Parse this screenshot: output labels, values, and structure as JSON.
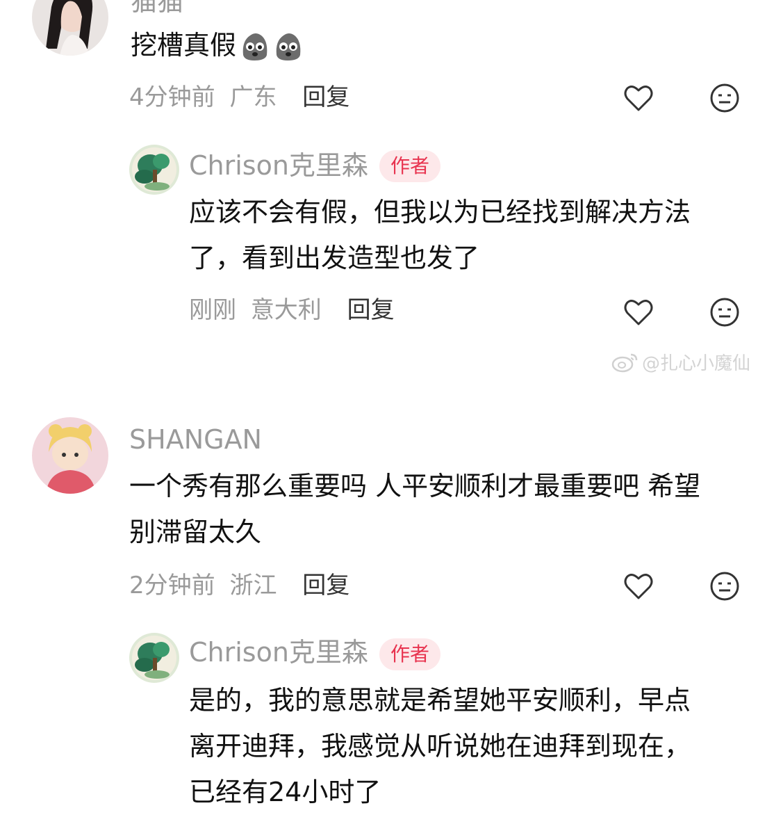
{
  "comments": [
    {
      "user": "猫猫",
      "text": "挖槽真假",
      "emoji_count": 2,
      "time": "4分钟前",
      "location": "广东",
      "reply_label": "回复",
      "replies": [
        {
          "user": "Chrison克里森",
          "badge": "作者",
          "text_line1": "应该不会有假，但我以为已经找到解决方法",
          "text_line2": "了，看到出发造型也发了",
          "time": "刚刚",
          "location": "意大利",
          "reply_label": "回复"
        }
      ]
    },
    {
      "user": "SHANGAN",
      "text_line1": "一个秀有那么重要吗 人平安顺利才最重要吧 希望",
      "text_line2": "别滞留太久",
      "time": "2分钟前",
      "location": "浙江",
      "reply_label": "回复",
      "replies": [
        {
          "user": "Chrison克里森",
          "badge": "作者",
          "text_line1": "是的，我的意思就是希望她平安顺利，早点",
          "text_line2": "离开迪拜，我感觉从听说她在迪拜到现在，",
          "text_line3": "已经有24小时了"
        }
      ]
    }
  ],
  "watermark": "@扎心小魔仙",
  "icons": [
    "heart-outline-icon",
    "neutral-face-icon",
    "weibo-logo-icon",
    "thinking-emoji-icon"
  ]
}
